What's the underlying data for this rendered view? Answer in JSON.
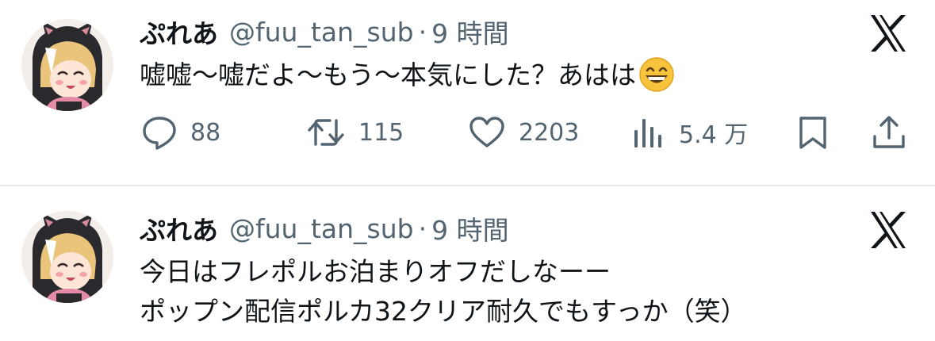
{
  "tweets": [
    {
      "author": {
        "display_name": "ぷれあ",
        "handle": "@fuu_tan_sub",
        "avatar_icon": "cat-ear-hood-avatar"
      },
      "separator": "·",
      "time": "9 時間",
      "text_lines": [
        "嘘嘘〜嘘だよ〜もう〜本気にした？あはは"
      ],
      "emoji": "grinning-face-emoji",
      "platform_icon": "x-logo-icon",
      "stats": {
        "replies": "88",
        "retweets": "115",
        "likes": "2203",
        "views": "5.4 万"
      },
      "action_icons": [
        "reply-icon",
        "retweet-icon",
        "like-icon",
        "views-icon",
        "bookmark-icon",
        "share-icon"
      ]
    },
    {
      "author": {
        "display_name": "ぷれあ",
        "handle": "@fuu_tan_sub",
        "avatar_icon": "cat-ear-hood-avatar"
      },
      "separator": "·",
      "time": "9 時間",
      "text_lines": [
        "今日はフレポルお泊まりオフだしなーー",
        "ポップン配信ポルカ32クリア耐久でもすっか（笑）"
      ],
      "platform_icon": "x-logo-icon"
    }
  ],
  "colors": {
    "text_primary": "#0f1419",
    "text_secondary": "#536471",
    "divider": "#e6e9ec",
    "background": "#ffffff"
  }
}
